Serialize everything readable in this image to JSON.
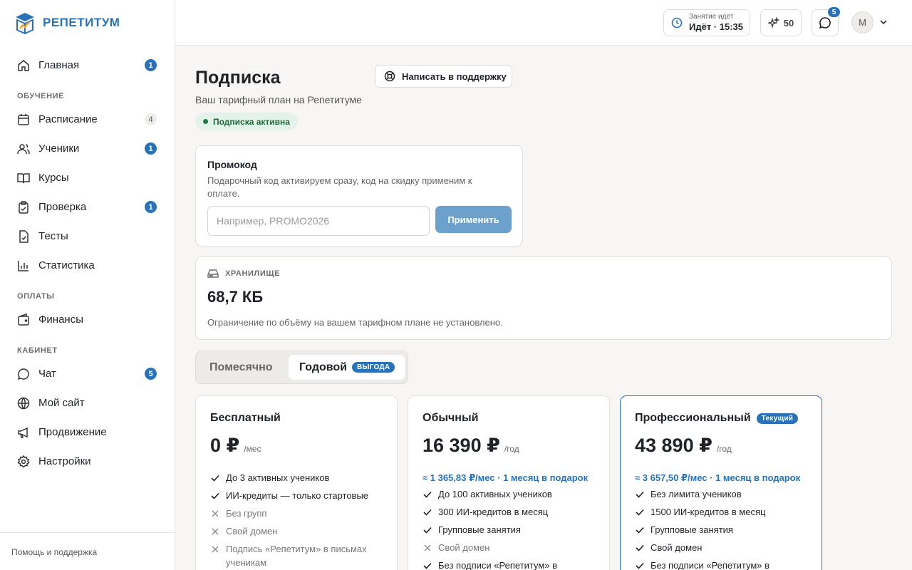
{
  "app": {
    "name": "РЕПЕТИТУМ",
    "accent": "#2a72b8"
  },
  "sidebar": {
    "items": [
      {
        "label": "Главная",
        "icon": "home-icon",
        "badge": "1"
      },
      {
        "section": "ОБУЧЕНИЕ"
      },
      {
        "label": "Расписание",
        "icon": "calendar-icon",
        "badge": "4",
        "badge_style": "grey"
      },
      {
        "label": "Ученики",
        "icon": "users-icon",
        "badge": "1"
      },
      {
        "label": "Курсы",
        "icon": "book-icon"
      },
      {
        "label": "Проверка",
        "icon": "clipboard-icon",
        "badge": "1"
      },
      {
        "label": "Тесты",
        "icon": "test-icon"
      },
      {
        "label": "Статистика",
        "icon": "chart-icon"
      },
      {
        "section": "ОПЛАТЫ"
      },
      {
        "label": "Финансы",
        "icon": "wallet-icon"
      },
      {
        "section": "КАБИНЕТ"
      },
      {
        "label": "Чат",
        "icon": "chat-icon",
        "badge": "5"
      },
      {
        "label": "Мой сайт",
        "icon": "globe-icon"
      },
      {
        "label": "Продвижение",
        "icon": "megaphone-icon"
      },
      {
        "label": "Настройки",
        "icon": "gear-icon"
      }
    ],
    "help": "Помощь и поддержка"
  },
  "header": {
    "lesson_small": "Занятие идёт",
    "lesson_big": "Идёт · 15:35",
    "credits": "50",
    "chat_badge": "5",
    "avatar": "M"
  },
  "page": {
    "title": "Подписка",
    "subtitle": "Ваш тарифный план на Репетитуме",
    "status": "Подписка активна",
    "support_button": "Написать в поддержку"
  },
  "promo": {
    "title": "Промокод",
    "description": "Подарочный код активируем сразу, код на скидку применим к оплате.",
    "placeholder": "Например, PROMO2026",
    "value": "",
    "apply": "Применить"
  },
  "storage": {
    "header": "ХРАНИЛИЩЕ",
    "value": "68,7 КБ",
    "note": "Ограничение по объёму на вашем тарифном плане не установлено."
  },
  "billing_toggle": {
    "monthly": "Помесячно",
    "yearly": "Годовой",
    "yearly_badge": "ВЫГОДА",
    "selected": "yearly"
  },
  "plans": [
    {
      "name": "Бесплатный",
      "price": "0 ₽",
      "period": "/мес",
      "monthly": "",
      "features": [
        {
          "text": "До 3 активных учеников",
          "on": true
        },
        {
          "text": "ИИ-кредиты — только стартовые",
          "on": true
        },
        {
          "text": "Без групп",
          "on": false
        },
        {
          "text": "Свой домен",
          "on": false
        },
        {
          "text": "Подпись «Репетитум» в письмах ученикам",
          "on": false
        }
      ]
    },
    {
      "name": "Обычный",
      "price": "16 390 ₽",
      "period": "/год",
      "monthly": "≈ 1 365,83 ₽/мес · 1 месяц в подарок",
      "features": [
        {
          "text": "До 100 активных учеников",
          "on": true
        },
        {
          "text": "300 ИИ-кредитов в месяц",
          "on": true
        },
        {
          "text": "Групповые занятия",
          "on": true
        },
        {
          "text": "Свой домен",
          "on": false
        },
        {
          "text": "Без подписи «Репетитум» в",
          "on": true
        }
      ]
    },
    {
      "name": "Профессиональный",
      "badge": "Текущий",
      "price": "43 890 ₽",
      "period": "/год",
      "monthly": "≈ 3 657,50 ₽/мес · 1 месяц в подарок",
      "features": [
        {
          "text": "Без лимита учеников",
          "on": true
        },
        {
          "text": "1500 ИИ-кредитов в месяц",
          "on": true
        },
        {
          "text": "Групповые занятия",
          "on": true
        },
        {
          "text": "Свой домен",
          "on": true
        },
        {
          "text": "Без подписи «Репетитум» в",
          "on": true
        }
      ]
    }
  ]
}
